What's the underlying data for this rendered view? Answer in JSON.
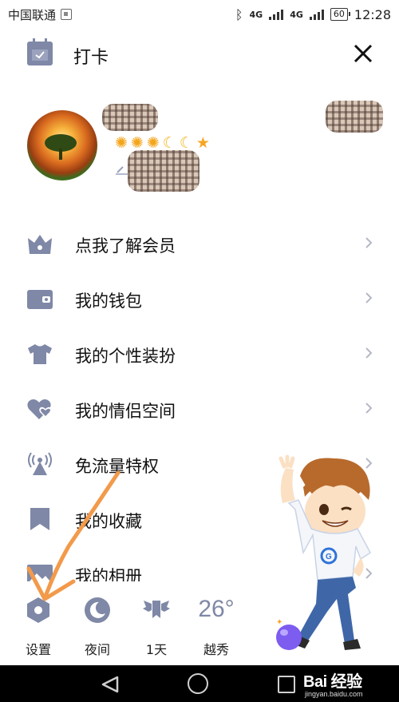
{
  "status_bar": {
    "carrier": "中国联通",
    "network_label": "4G",
    "network_label_2": "4G",
    "battery": "60",
    "time": "12:28"
  },
  "header": {
    "title": "打卡",
    "checkin_icon": "calendar-check-icon",
    "close_icon": "close-icon"
  },
  "profile": {
    "badges": [
      "sun",
      "sun",
      "sun",
      "moon",
      "moon",
      "star"
    ]
  },
  "menu": [
    {
      "label": "点我了解会员",
      "icon": "vip-crown-icon"
    },
    {
      "label": "我的钱包",
      "icon": "wallet-icon"
    },
    {
      "label": "我的个性装扮",
      "icon": "tshirt-icon"
    },
    {
      "label": "我的情侣空间",
      "icon": "couple-heart-icon"
    },
    {
      "label": "免流量特权",
      "icon": "signal-tower-icon"
    },
    {
      "label": "我的收藏",
      "icon": "bookmark-icon"
    },
    {
      "label": "我的相册",
      "icon": "album-icon"
    }
  ],
  "toolbar": {
    "settings_label": "设置",
    "night_label": "夜间",
    "days_label": "1天",
    "weather_temp": "26°",
    "weather_city": "越秀"
  },
  "watermark": {
    "main": "Bai  经验",
    "sub": "jingyan.baidu.com"
  },
  "colors": {
    "icon_gray": "#7f88a6",
    "chevron": "#b5b8c4",
    "arrow_orange": "#f29a4a"
  }
}
